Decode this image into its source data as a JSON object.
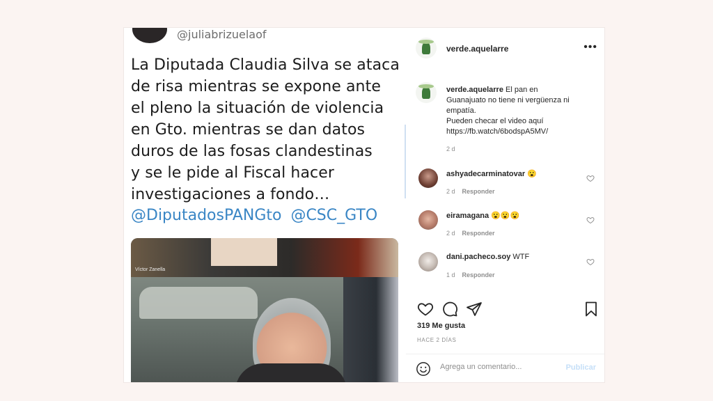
{
  "tweet": {
    "handle": "@juliabrizuelaof",
    "lines": [
      "La Diputada Claudia Silva se ataca",
      "de risa mientras se expone ante",
      "el pleno la situación de violencia",
      "en Gto. mientras se dan datos",
      "duros de las fosas clandestinas",
      "y se le pide al Fiscal hacer",
      "investigaciones a fondo…"
    ],
    "mentions": "@DiputadosPANGto  @CSC_GTO",
    "video_name_tag": "Víctor Zanella"
  },
  "post": {
    "author": "verde.aquelarre",
    "more_icon": "more-options-icon",
    "caption": {
      "author": "verde.aquelarre",
      "lines": [
        "El pan en",
        "Guanajuato no tiene ni vergüenza ni",
        "empatía.",
        "Pueden checar el video aquí",
        "https://fb.watch/6bodspA5MV/"
      ],
      "time": "2 d"
    },
    "comments": [
      {
        "user": "ashyadecarminatovar",
        "text": "😮",
        "time": "2 d",
        "reply": "Responder"
      },
      {
        "user": "eiramagana",
        "text": "😮😮😮",
        "time": "2 d",
        "reply": "Responder"
      },
      {
        "user": "dani.pacheco.soy",
        "text": "WTF",
        "time": "1 d",
        "reply": "Responder"
      }
    ],
    "likes": "319 Me gusta",
    "ago": "HACE 2 DÍAS",
    "add_comment_placeholder": "Agrega un comentario...",
    "publish_label": "Publicar"
  },
  "colors": {
    "background": "#fbf4f2",
    "mention_blue": "#3a86c5",
    "publish_disabled": "#c5dff8",
    "muted_text": "#8e8e8e"
  }
}
